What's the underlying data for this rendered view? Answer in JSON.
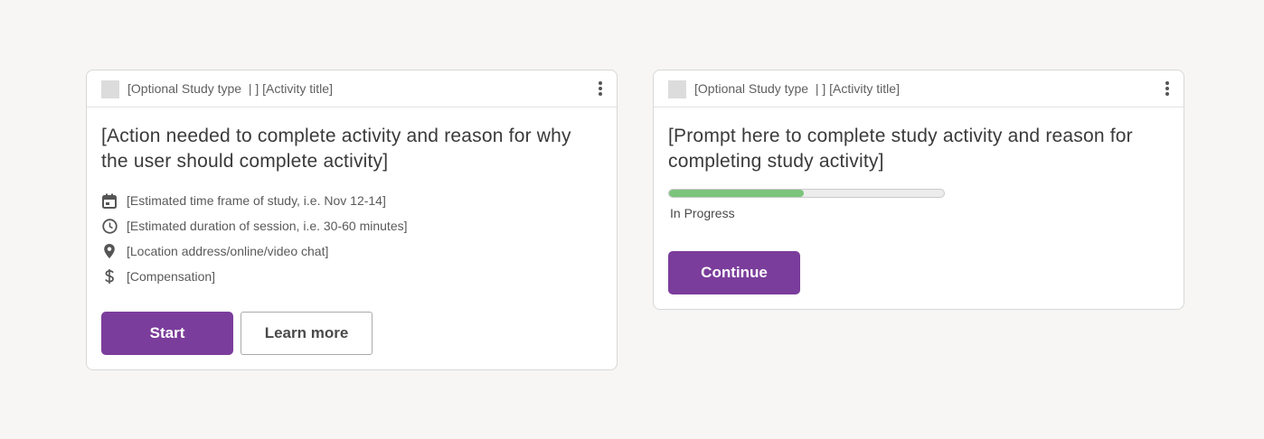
{
  "colors": {
    "background": "#f7f6f5",
    "primary_button": "#7b3d9b",
    "progress_fill": "#7cc47c",
    "progress_track": "#ececec"
  },
  "card1": {
    "header_text": "[Optional Study type  | ] [Activity title]",
    "prompt": "[Action needed to complete activity and reason for why the user should complete activity]",
    "details": [
      {
        "icon": "calendar-icon",
        "text": "[Estimated time frame of study, i.e. Nov 12-14]"
      },
      {
        "icon": "clock-icon",
        "text": "[Estimated duration of session, i.e. 30-60 minutes]"
      },
      {
        "icon": "location-pin-icon",
        "text": "[Location address/online/video chat]"
      },
      {
        "icon": "dollar-icon",
        "text": "[Compensation]"
      }
    ],
    "start_label": "Start",
    "learn_more_label": "Learn more"
  },
  "card2": {
    "header_text": "[Optional Study type  | ] [Activity title]",
    "prompt": "[Prompt here to complete study activity and reason for completing study activity]",
    "progress": 0.49,
    "progress_label": "In Progress",
    "continue_label": "Continue"
  }
}
